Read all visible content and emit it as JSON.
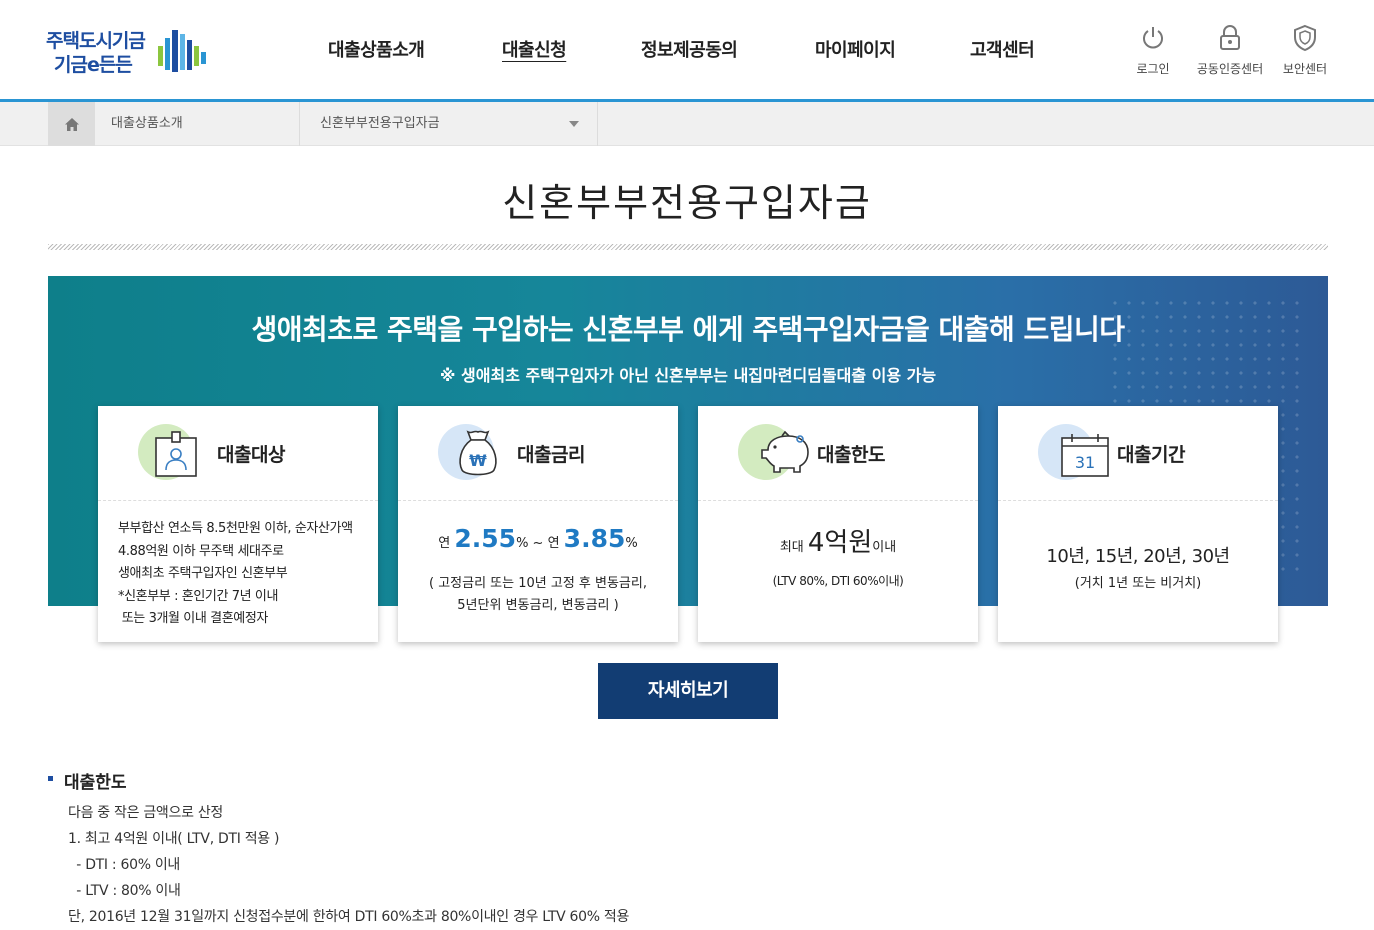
{
  "header": {
    "logo_line1": "주택도시기금",
    "logo_line2": "기금e든든",
    "nav": [
      "대출상품소개",
      "대출신청",
      "정보제공동의",
      "마이페이지",
      "고객센터"
    ],
    "util": {
      "login": "로그인",
      "cert": "공동인증센터",
      "security": "보안센터"
    }
  },
  "breadcrumb": {
    "item1": "대출상품소개",
    "item2": "신혼부부전용구입자금"
  },
  "page_title": "신혼부부전용구입자금",
  "banner": {
    "title": "생애최초로 주택을 구입하는 신혼부부 에게  주택구입자금을 대출해 드립니다",
    "note": "※ 생애최초 주택구입자가 아닌 신혼부부는 내집마련디딤돌대출 이용 가능"
  },
  "cards": {
    "target": {
      "title": "대출대상",
      "lines": [
        "부부합산 연소득 8.5천만원 이하, 순자산가액",
        "4.88억원 이하 무주택 세대주로",
        "생애최초 주택구입자인 신혼부부",
        "*신혼부부 : 혼인기간 7년 이내",
        " 또는 3개월 이내 결혼예정자"
      ]
    },
    "rate": {
      "title": "대출금리",
      "prefix1": "연 ",
      "rate_low": "2.55",
      "pct1": "% ~ 연 ",
      "rate_high": "3.85",
      "pct2": "%",
      "note1": "( 고정금리 또는 10년 고정 후 변동금리,",
      "note2": "5년단위 변동금리, 변동금리 )"
    },
    "limit": {
      "title": "대출한도",
      "prefix": "최대 ",
      "amount": "4억원",
      "suffix": "이내",
      "note": "(LTV 80%, DTI 60%이내)"
    },
    "period": {
      "title": "대출기간",
      "value": "10년, 15년, 20년, 30년",
      "note": "(거치 1년 또는 비거치)",
      "calendar_day": "31"
    }
  },
  "more_button": "자세히보기",
  "detail": {
    "title": "대출한도",
    "lines": [
      "다음 중 작은 금액으로 산정",
      "1. 최고 4억원 이내( LTV, DTI 적용 )",
      "  - DTI : 60% 이내",
      "  - LTV : 80% 이내",
      "단, 2016년 12월 31일까지 신청접수분에 한하여 DTI 60%초과 80%이내인 경우 LTV 60% 적용"
    ]
  },
  "colors": {
    "brand": "#1e4ea1",
    "accent": "#2a95d3",
    "button": "#123d73",
    "rate_blue": "#1f7ac3"
  }
}
